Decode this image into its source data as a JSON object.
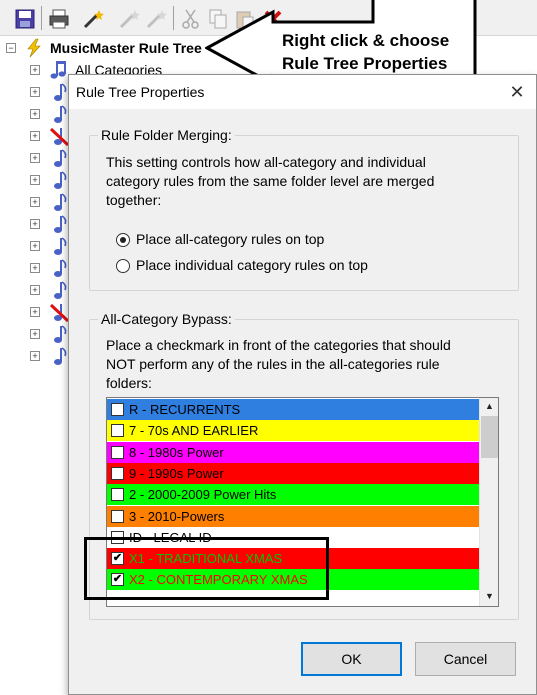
{
  "toolbar": {
    "icons": [
      "save-icon",
      "print-icon",
      "wand-icon",
      "wand-disabled-icon",
      "wand-disabled-icon",
      "cut-icon",
      "copy-icon",
      "paste-icon",
      "delete-icon"
    ]
  },
  "tree": {
    "root_label": "MusicMaster Rule Tree",
    "first_child_label": "All Categories",
    "expander_symbol_root": "−",
    "expander_symbol_child": "+"
  },
  "callout": {
    "line1": "Right click & choose",
    "line2": "Rule Tree Properties"
  },
  "dialog": {
    "title": "Rule Tree Properties",
    "close_glyph": "✕",
    "merging": {
      "label": "Rule Folder Merging:",
      "desc_lines": [
        "This setting controls how all-category and individual",
        "category rules from the same folder level are merged",
        "together:"
      ],
      "options": [
        {
          "label": "Place all-category rules on top",
          "selected": true
        },
        {
          "label": "Place individual category rules on top",
          "selected": false
        }
      ]
    },
    "bypass": {
      "label": "All-Category Bypass:",
      "desc_lines": [
        "Place a checkmark in front of the categories that should",
        "NOT perform any of the rules in the all-categories rule",
        "folders:"
      ],
      "items": [
        {
          "text": "R - RECURRENTS",
          "bg": "#2f7fe0",
          "fg": "#000000",
          "checked": false
        },
        {
          "text": "7 - 70s AND EARLIER",
          "bg": "#ffff00",
          "fg": "#000000",
          "checked": false
        },
        {
          "text": "8 - 1980s Power",
          "bg": "#ff00ff",
          "fg": "#000000",
          "checked": false
        },
        {
          "text": "9 - 1990s Power",
          "bg": "#ff0000",
          "fg": "#000000",
          "checked": false
        },
        {
          "text": "2 - 2000-2009 Power Hits",
          "bg": "#00ff00",
          "fg": "#000000",
          "checked": false
        },
        {
          "text": "3 - 2010-Powers",
          "bg": "#ff8000",
          "fg": "#000000",
          "checked": false
        },
        {
          "text": "ID - LEGAL ID",
          "bg": "#ffffff",
          "fg": "#000000",
          "checked": false
        },
        {
          "text": "X1 - TRADITIONAL XMAS",
          "bg": "#ff0000",
          "fg": "#00c800",
          "checked": true
        },
        {
          "text": "X2 - CONTEMPORARY XMAS",
          "bg": "#00ff00",
          "fg": "#ff0000",
          "checked": true
        }
      ]
    },
    "ok_label": "OK",
    "cancel_label": "Cancel"
  },
  "check_glyph": "✔",
  "scroll": {
    "up_glyph": "▲",
    "down_glyph": "▼"
  }
}
